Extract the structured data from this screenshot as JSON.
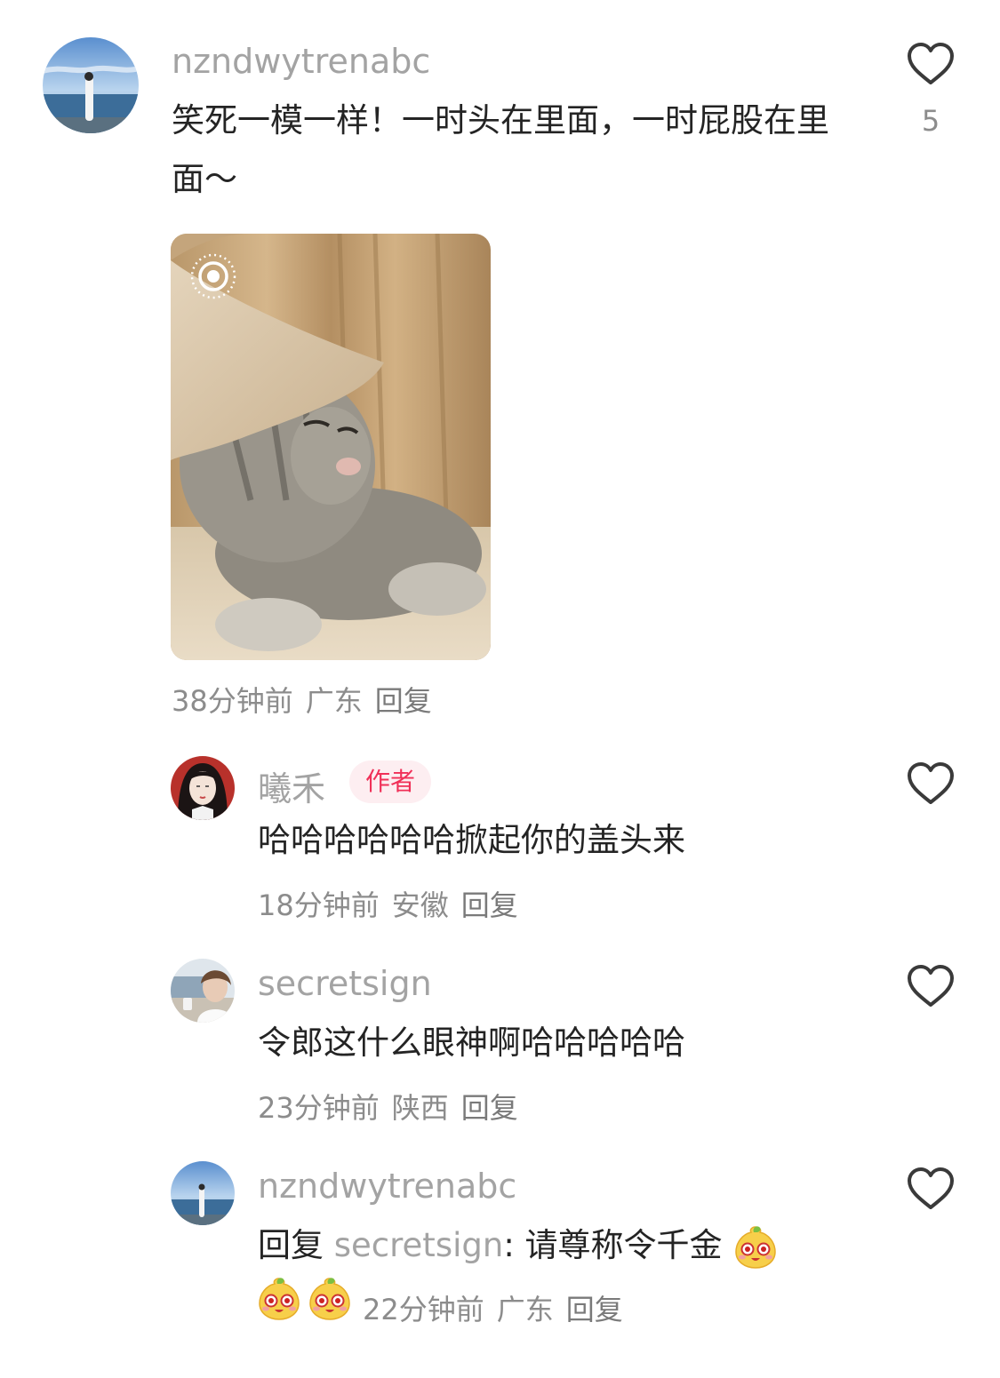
{
  "comment": {
    "username": "nzndwytrenabc",
    "text": "笑死一模一样！一时头在里面，一时屁股在里面～",
    "like_count": "5",
    "time": "38分钟前",
    "location": "广东",
    "reply_label": "回复"
  },
  "replies": [
    {
      "username": "曦禾",
      "badge": "作者",
      "text": "哈哈哈哈哈哈掀起你的盖头来",
      "time": "18分钟前",
      "location": "安徽",
      "reply_label": "回复"
    },
    {
      "username": "secretsign",
      "text": "令郎这什么眼神啊哈哈哈哈哈",
      "time": "23分钟前",
      "location": "陕西",
      "reply_label": "回复"
    },
    {
      "username": "nzndwytrenabc",
      "reply_prefix": "回复",
      "mention": "secretsign",
      "text": ": 请尊称令千金",
      "time": "22分钟前",
      "location": "广东",
      "reply_label": "回复"
    }
  ],
  "icons": {
    "like": "heart-outline-icon",
    "live_photo": "live-photo-icon",
    "emoji": "mango-face-emoji-icon"
  },
  "colors": {
    "username": "#a3a3a3",
    "text": "#242424",
    "meta": "#8c8c8c",
    "badge_bg": "#fdeef1",
    "badge_text": "#f03058"
  }
}
